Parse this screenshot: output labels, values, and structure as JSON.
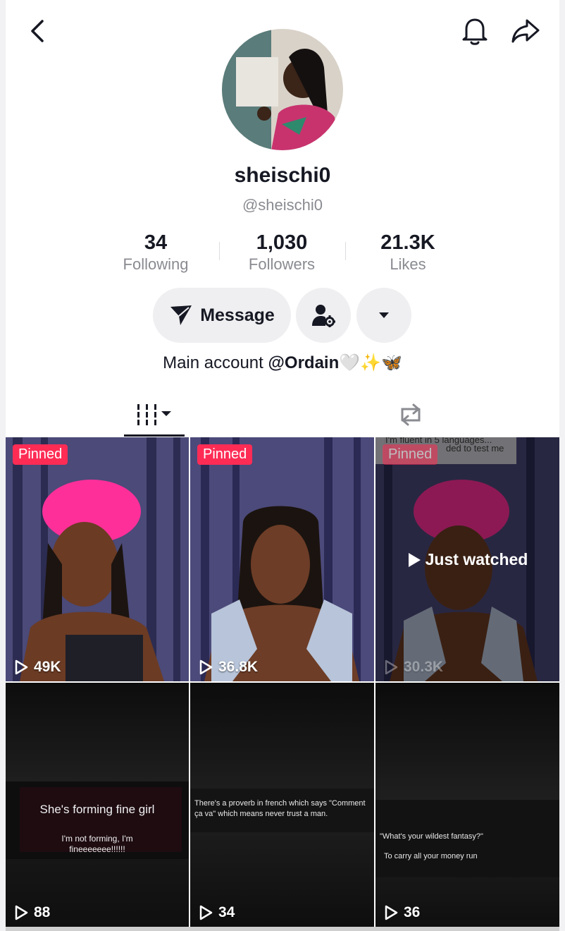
{
  "profile": {
    "display_name": "sheischi0",
    "handle": "@sheischi0",
    "bio_prefix": "Main account ",
    "bio_mention": "@Ordain",
    "bio_suffix": "🤍✨🦋"
  },
  "stats": [
    {
      "value": "34",
      "label": "Following"
    },
    {
      "value": "1,030",
      "label": "Followers"
    },
    {
      "value": "21.3K",
      "label": "Likes"
    }
  ],
  "actions": {
    "message_label": "Message"
  },
  "icons": {
    "back": "chevron-left-icon",
    "bell": "bell-icon",
    "share": "share-arrow-icon",
    "message": "send-icon",
    "add_friend": "user-settings-icon",
    "more": "caret-down-icon",
    "videos_tab": "grid-icon",
    "reposts_tab": "repost-icon"
  },
  "colors": {
    "pinned_badge": "#fe2c55",
    "pill_bg": "#efeff1"
  },
  "videos": [
    {
      "pinned_label": "Pinned",
      "views": "49K"
    },
    {
      "pinned_label": "Pinned",
      "views": "36.8K"
    },
    {
      "pinned_label": "Pinned",
      "views": "30.3K",
      "status": "Just watched",
      "overlay_top": "I'm fluent in 5 languages...",
      "overlay_top2": "ded to test me"
    },
    {
      "views": "88",
      "caption_title": "She's forming fine girl",
      "caption_body": "I'm not forming, I'm fineeeeeee!!!!!!"
    },
    {
      "views": "34",
      "caption_body": "There's a proverb in french which says \"Comment ça va\" which means never trust a man."
    },
    {
      "views": "36",
      "caption_q": "\"What's your wildest fantasy?\"",
      "caption_a": "To carry all your money run"
    }
  ]
}
